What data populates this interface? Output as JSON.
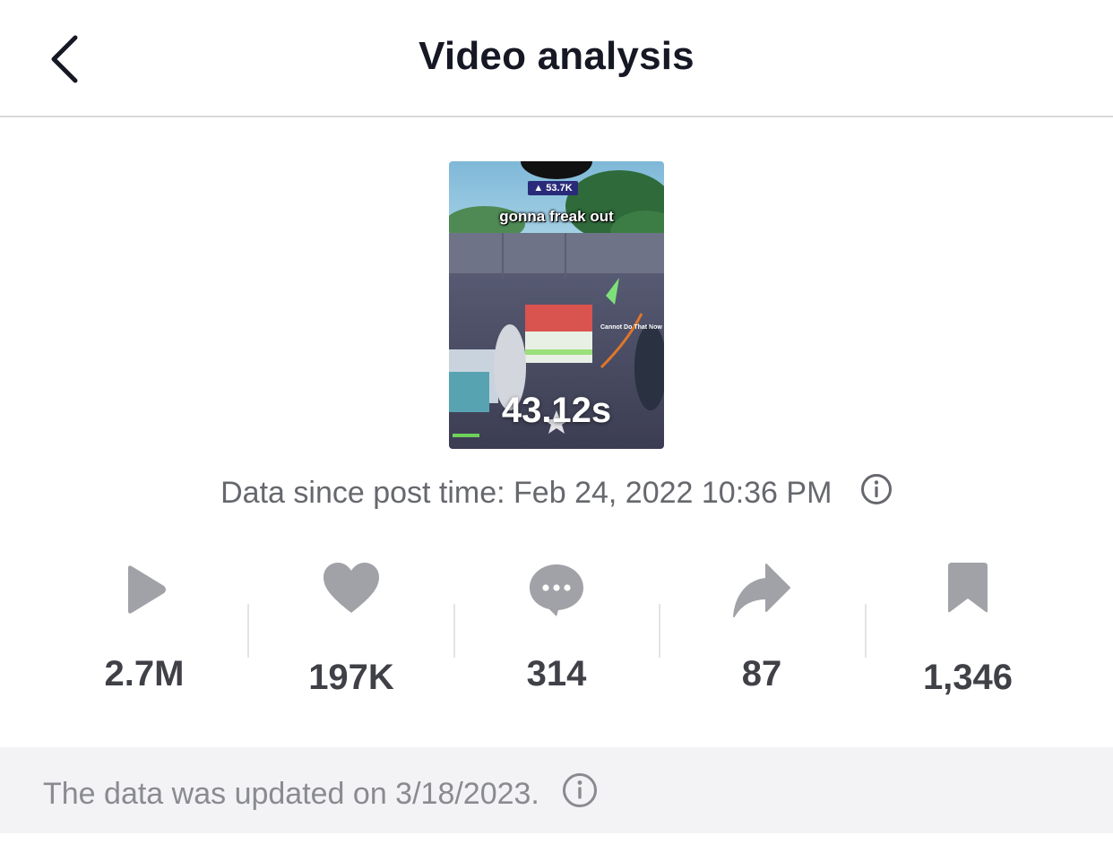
{
  "header": {
    "title": "Video analysis",
    "back_icon": "chevron-left-icon"
  },
  "video": {
    "duration": "43.12s",
    "caption": "gonna freak out",
    "overlay_views": "▲ 53.7K",
    "overlay_message": "Cannot Do That Now"
  },
  "post_info": {
    "label": "Data since post time: Feb 24, 2022 10:36 PM",
    "info_icon": "info-icon"
  },
  "stats": [
    {
      "name": "views",
      "icon": "play-icon",
      "value": "2.7M"
    },
    {
      "name": "likes",
      "icon": "heart-icon",
      "value": "197K"
    },
    {
      "name": "comments",
      "icon": "comment-icon",
      "value": "314"
    },
    {
      "name": "shares",
      "icon": "share-icon",
      "value": "87"
    },
    {
      "name": "favorites",
      "icon": "bookmark-icon",
      "value": "1,346"
    }
  ],
  "footer": {
    "text": "The data was updated on 3/18/2023.",
    "info_icon": "info-icon"
  },
  "colors": {
    "icon_gray": "#a1a2a7",
    "text_dark": "#161823",
    "stat_value": "#3f4147",
    "muted": "#8a8b91",
    "footer_bg": "#f3f3f5"
  }
}
